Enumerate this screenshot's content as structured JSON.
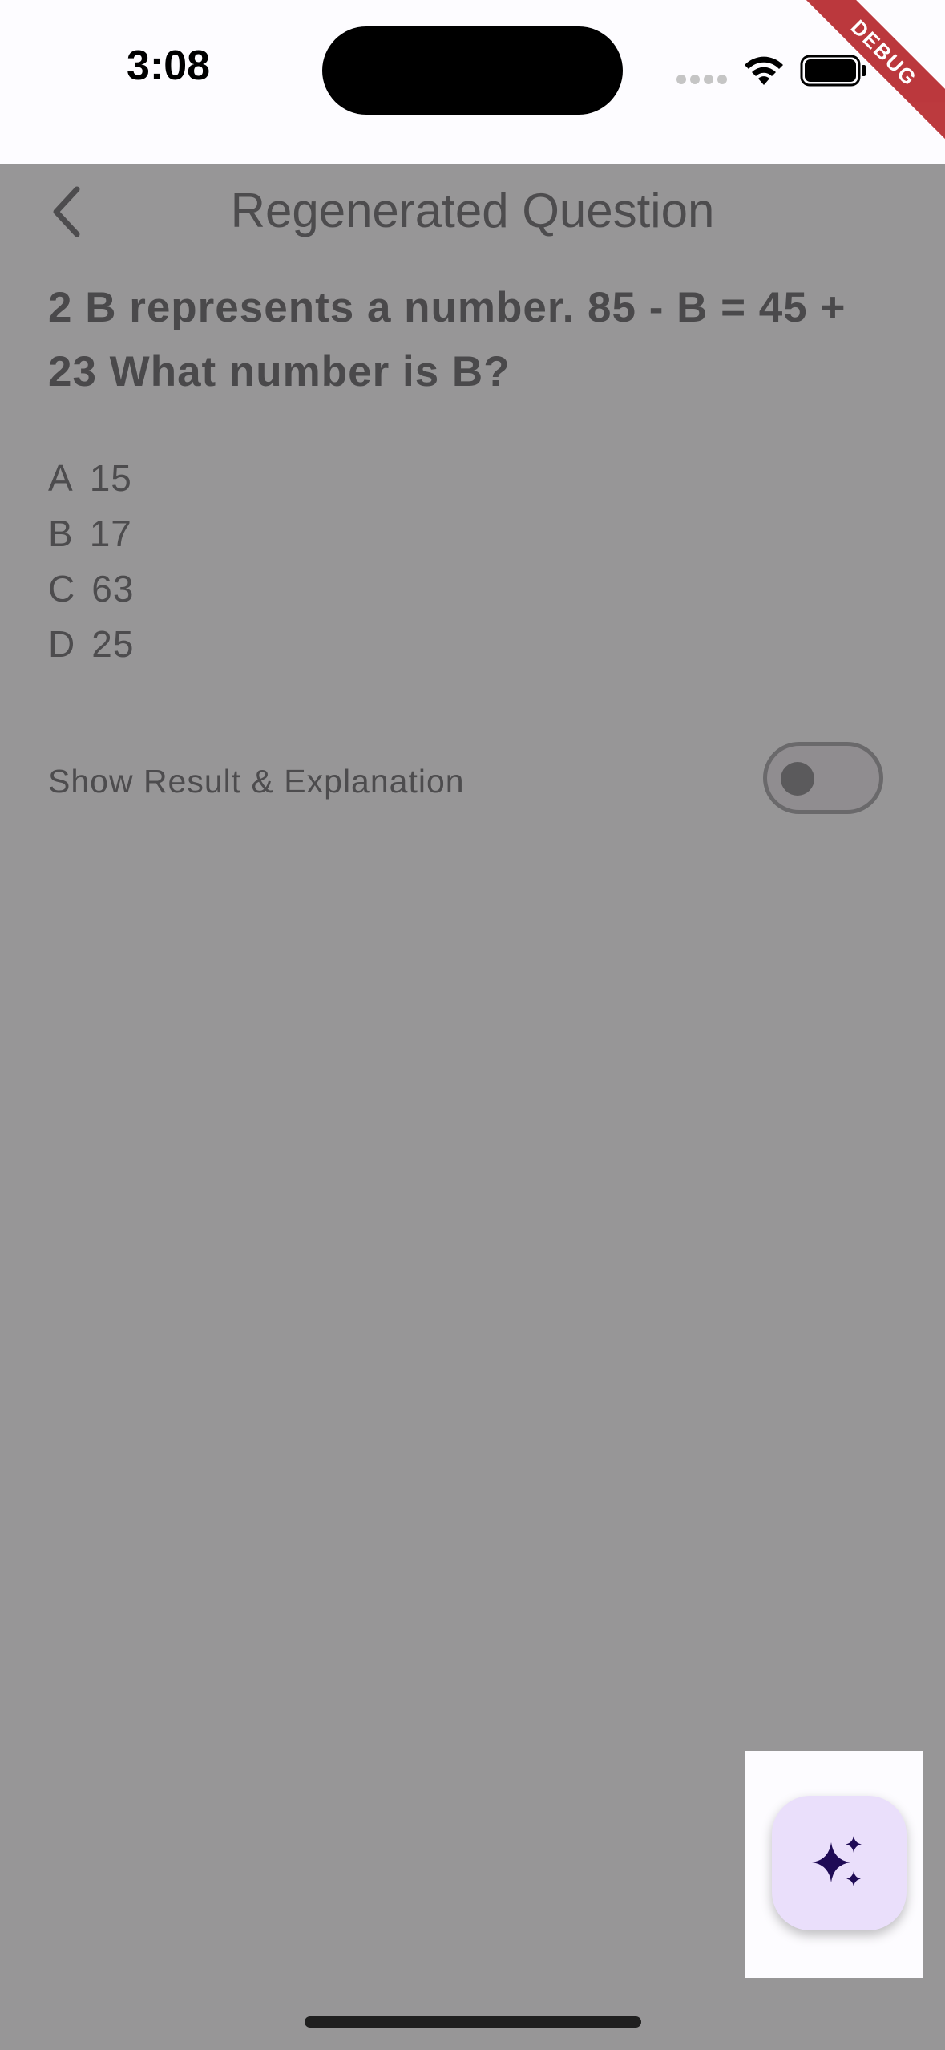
{
  "status_bar": {
    "time": "3:08",
    "debug_label": "DEBUG"
  },
  "app_bar": {
    "title": "Regenerated Question",
    "back_icon": "chevron-left-icon"
  },
  "question": {
    "text": "2 B represents a number. 85 - B = 45 + 23 What number is B?"
  },
  "options": [
    {
      "letter": "A",
      "value": "15"
    },
    {
      "letter": "B",
      "value": "17"
    },
    {
      "letter": "C",
      "value": "63"
    },
    {
      "letter": "D",
      "value": "25"
    }
  ],
  "toggle": {
    "label": "Show Result & Explanation",
    "on": false
  },
  "fab": {
    "icon": "sparkle-icon"
  },
  "colors": {
    "overlay": "#979697",
    "fab_background": "#eadffb",
    "fab_icon": "#1f0b55",
    "debug_ribbon": "#b0171c"
  }
}
